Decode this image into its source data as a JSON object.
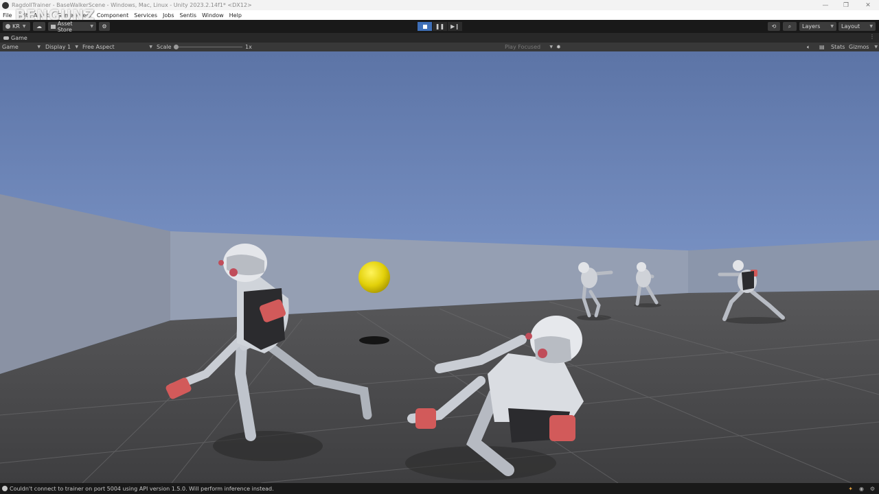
{
  "window": {
    "title": "RagdollTrainer - BaseWalkerScene - Windows, Mac, Linux - Unity 2023.2.14f1* <DX12>",
    "controls": [
      "—",
      "❐",
      "✕"
    ]
  },
  "watermark": "BENGUNZ",
  "menu": [
    "File",
    "Edit",
    "Assets",
    "GameObject",
    "Component",
    "Services",
    "Jobs",
    "Sentis",
    "Window",
    "Help"
  ],
  "toolbar": {
    "account": "KR",
    "asset_store": "Asset Store",
    "layers": "Layers",
    "layout": "Layout"
  },
  "tab": {
    "label": "Game"
  },
  "gamebar": {
    "mode": "Game",
    "display": "Display 1",
    "aspect": "Free Aspect",
    "scale_label": "Scale",
    "scale_value": "1x",
    "play_focused": "Play Focused",
    "stats": "Stats",
    "gizmos": "Gizmos"
  },
  "status": {
    "message": "Couldn't connect to trainer on port 5004 using API version 1.5.0. Will perform inference instead."
  },
  "colors": {
    "sky_top": "#5c74a6",
    "sky_bottom": "#aac4ea",
    "wall": "#8a94a8",
    "floor": "#4a4a4c",
    "ball": "#e8d80c",
    "robot_body": "#d0d4da",
    "robot_accent": "#d25a5a",
    "play_active": "#5a8ad8"
  }
}
